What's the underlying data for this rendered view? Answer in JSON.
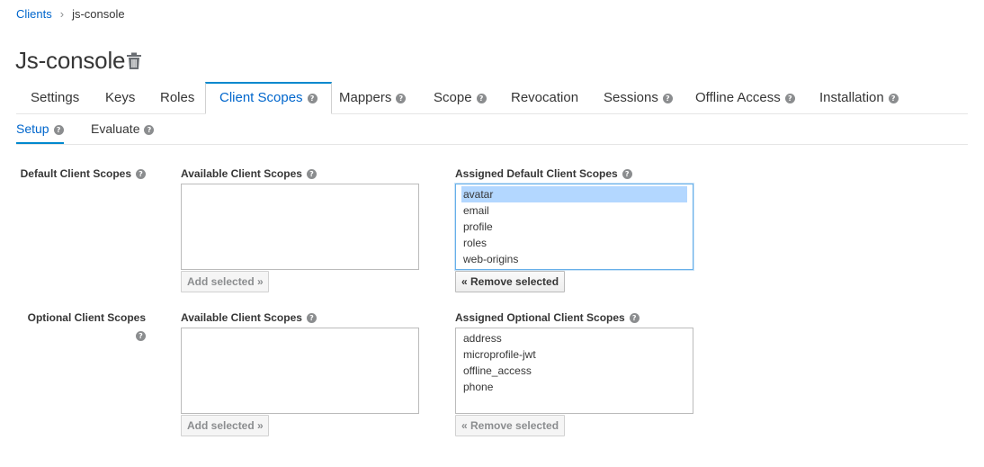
{
  "breadcrumb": {
    "parent": "Clients",
    "separator": "›",
    "current": "js-console"
  },
  "title": "Js-console",
  "help_glyph": "?",
  "tabs": [
    {
      "label": "Settings",
      "help": false
    },
    {
      "label": "Keys",
      "help": false
    },
    {
      "label": "Roles",
      "help": false
    },
    {
      "label": "Client Scopes",
      "help": true,
      "active": true
    },
    {
      "label": "Mappers",
      "help": true
    },
    {
      "label": "Scope",
      "help": true
    },
    {
      "label": "Revocation",
      "help": false
    },
    {
      "label": "Sessions",
      "help": true
    },
    {
      "label": "Offline Access",
      "help": true
    },
    {
      "label": "Installation",
      "help": true
    }
  ],
  "subtabs": [
    {
      "label": "Setup",
      "active": true
    },
    {
      "label": "Evaluate",
      "active": false
    }
  ],
  "default_scopes": {
    "row_label": "Default Client Scopes",
    "available_label": "Available Client Scopes",
    "available_items": [],
    "add_button": "Add selected »",
    "assigned_label": "Assigned Default Client Scopes",
    "assigned_items": [
      "avatar",
      "email",
      "profile",
      "roles",
      "web-origins"
    ],
    "selected_item": "avatar",
    "remove_button": "« Remove selected"
  },
  "optional_scopes": {
    "row_label": "Optional Client Scopes",
    "available_label": "Available Client Scopes",
    "available_items": [],
    "add_button": "Add selected »",
    "assigned_label": "Assigned Optional Client Scopes",
    "assigned_items": [
      "address",
      "microprofile-jwt",
      "offline_access",
      "phone"
    ],
    "remove_button": "« Remove selected"
  },
  "colors": {
    "link": "#0066cc",
    "active_border": "#0088ce",
    "selected_option": "#b3d7ff"
  }
}
